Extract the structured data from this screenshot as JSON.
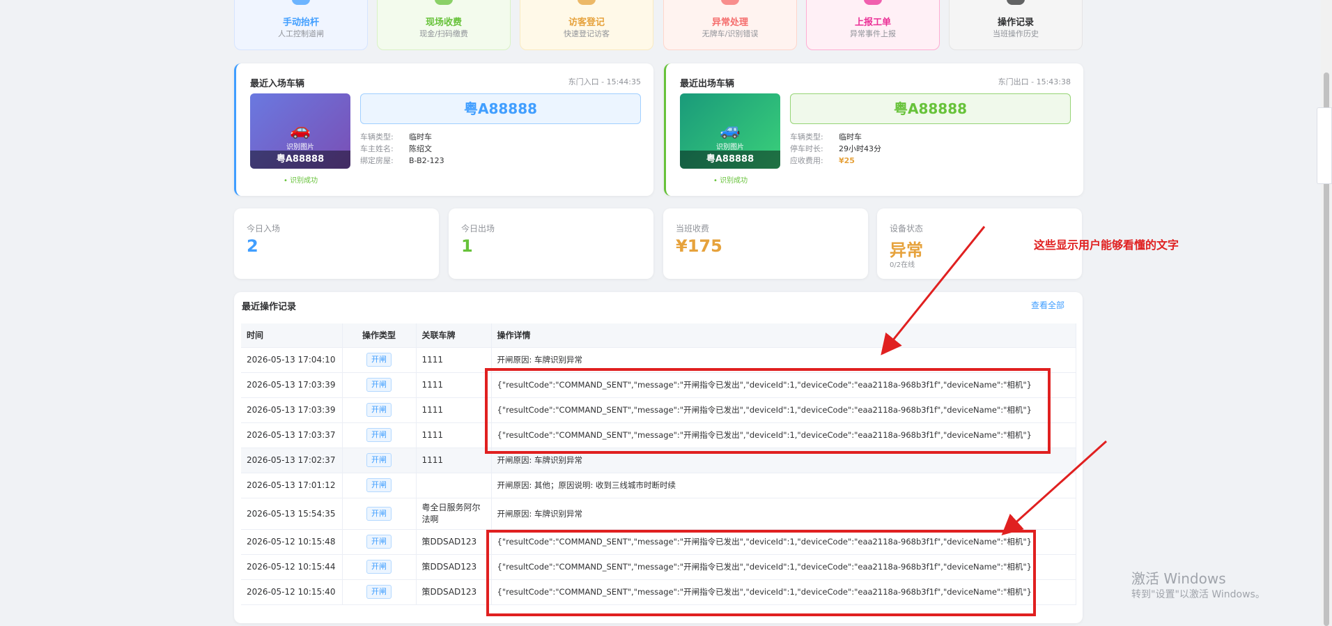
{
  "quick_actions": [
    {
      "title": "手动抬杆",
      "sub": "人工控制道闸",
      "icon": "barrier-icon",
      "color": "#409eff",
      "bg": "#f0f5ff",
      "border": "#d6e4ff"
    },
    {
      "title": "现场收费",
      "sub": "现金/扫码缴费",
      "icon": "money-bag-icon",
      "color": "#67c23a",
      "bg": "#f3fbed",
      "border": "#d9f2c5"
    },
    {
      "title": "访客登记",
      "sub": "快速登记访客",
      "icon": "person-icon",
      "color": "#e6a23c",
      "bg": "#fff9e8",
      "border": "#faeac0"
    },
    {
      "title": "异常处理",
      "sub": "无牌车/识别错误",
      "icon": "warning-icon",
      "color": "#f56c6c",
      "bg": "#fff3f0",
      "border": "#ffd6cc"
    },
    {
      "title": "上报工单",
      "sub": "异常事件上报",
      "icon": "memo-icon",
      "color": "#eb2f96",
      "bg": "#fff0f6",
      "border": "#ffadd2"
    },
    {
      "title": "操作记录",
      "sub": "当班操作历史",
      "icon": "record-icon",
      "color": "#303133",
      "bg": "#f5f5f5",
      "border": "#e4e4e4"
    }
  ],
  "entry": {
    "title": "最近入场车辆",
    "meta": "东门入口 - 15:44:35",
    "plate": "粤A88888",
    "photo_label": "识别图片",
    "photo_plate": "粤A88888",
    "status": "• 识别成功",
    "fields": [
      {
        "k": "车辆类型:",
        "v": "临时车"
      },
      {
        "k": "车主姓名:",
        "v": "陈绍文"
      },
      {
        "k": "绑定房屋:",
        "v": "B-B2-123"
      }
    ]
  },
  "exit": {
    "title": "最近出场车辆",
    "meta": "东门出口 - 15:43:38",
    "plate": "粤A88888",
    "photo_label": "识别图片",
    "photo_plate": "粤A88888",
    "status": "• 识别成功",
    "fields": [
      {
        "k": "车辆类型:",
        "v": "临时车"
      },
      {
        "k": "停车时长:",
        "v": "29小时43分"
      },
      {
        "k": "应收费用:",
        "v": "¥25"
      }
    ]
  },
  "stats": [
    {
      "label": "今日入场",
      "value": "2",
      "color": "#409eff",
      "sub": ""
    },
    {
      "label": "今日出场",
      "value": "1",
      "color": "#67c23a",
      "sub": ""
    },
    {
      "label": "当班收费",
      "value": "¥175",
      "color": "#e6a23c",
      "sub": ""
    },
    {
      "label": "设备状态",
      "value": "异常",
      "color": "#e6a23c",
      "sub": "0/2在线"
    }
  ],
  "records": {
    "title": "最近操作记录",
    "view_all": "查看全部",
    "columns": [
      "时间",
      "操作类型",
      "关联车牌",
      "操作详情"
    ],
    "rows": [
      {
        "time": "2026-05-13 17:04:10",
        "type": "开闸",
        "plate": "1111",
        "detail": "开闸原因: 车牌识别异常"
      },
      {
        "time": "2026-05-13 17:03:39",
        "type": "开闸",
        "plate": "1111",
        "detail": "{\"resultCode\":\"COMMAND_SENT\",\"message\":\"开闸指令已发出\",\"deviceId\":1,\"deviceCode\":\"eaa2118a-968b3f1f\",\"deviceName\":\"相机\"}"
      },
      {
        "time": "2026-05-13 17:03:39",
        "type": "开闸",
        "plate": "1111",
        "detail": "{\"resultCode\":\"COMMAND_SENT\",\"message\":\"开闸指令已发出\",\"deviceId\":1,\"deviceCode\":\"eaa2118a-968b3f1f\",\"deviceName\":\"相机\"}"
      },
      {
        "time": "2026-05-13 17:03:37",
        "type": "开闸",
        "plate": "1111",
        "detail": "{\"resultCode\":\"COMMAND_SENT\",\"message\":\"开闸指令已发出\",\"deviceId\":1,\"deviceCode\":\"eaa2118a-968b3f1f\",\"deviceName\":\"相机\"}"
      },
      {
        "time": "2026-05-13 17:02:37",
        "type": "开闸",
        "plate": "1111",
        "detail": "开闸原因: 车牌识别异常"
      },
      {
        "time": "2026-05-13 17:01:12",
        "type": "开闸",
        "plate": "",
        "detail": "开闸原因: 其他；原因说明: 收到三线城市时断时续"
      },
      {
        "time": "2026-05-13 15:54:35",
        "type": "开闸",
        "plate": "粤全日服务阿尔法啊",
        "detail": "开闸原因: 车牌识别异常"
      },
      {
        "time": "2026-05-12 10:15:48",
        "type": "开闸",
        "plate": "策DDSAD123",
        "detail": "{\"resultCode\":\"COMMAND_SENT\",\"message\":\"开闸指令已发出\",\"deviceId\":1,\"deviceCode\":\"eaa2118a-968b3f1f\",\"deviceName\":\"相机\"}"
      },
      {
        "time": "2026-05-12 10:15:44",
        "type": "开闸",
        "plate": "策DDSAD123",
        "detail": "{\"resultCode\":\"COMMAND_SENT\",\"message\":\"开闸指令已发出\",\"deviceId\":1,\"deviceCode\":\"eaa2118a-968b3f1f\",\"deviceName\":\"相机\"}"
      },
      {
        "time": "2026-05-12 10:15:40",
        "type": "开闸",
        "plate": "策DDSAD123",
        "detail": "{\"resultCode\":\"COMMAND_SENT\",\"message\":\"开闸指令已发出\",\"deviceId\":1,\"deviceCode\":\"eaa2118a-968b3f1f\",\"deviceName\":\"相机\"}"
      }
    ]
  },
  "annotation": "这些显示用户能够看懂的文字",
  "watermark": {
    "line1": "激活 Windows",
    "line2": "转到\"设置\"以激活 Windows。"
  }
}
